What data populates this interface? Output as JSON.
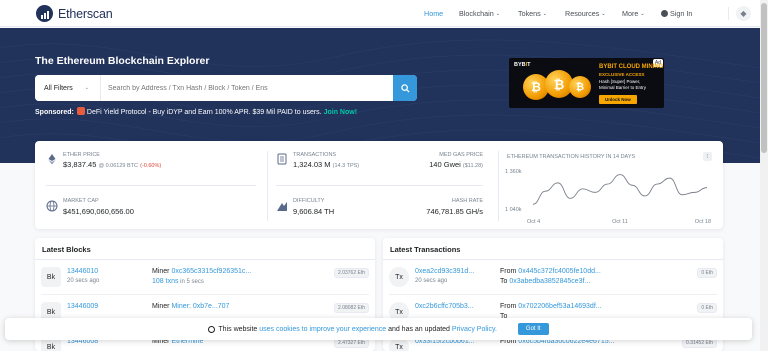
{
  "header": {
    "logo_text": "Etherscan",
    "nav": [
      {
        "label": "Home",
        "dropdown": false,
        "active": true
      },
      {
        "label": "Blockchain",
        "dropdown": true,
        "active": false
      },
      {
        "label": "Tokens",
        "dropdown": true,
        "active": false
      },
      {
        "label": "Resources",
        "dropdown": true,
        "active": false
      },
      {
        "label": "More",
        "dropdown": true,
        "active": false
      },
      {
        "label": "Sign In",
        "dropdown": false,
        "active": false
      }
    ]
  },
  "hero": {
    "title": "The Ethereum Blockchain Explorer",
    "filter_label": "All Filters",
    "search_placeholder": "Search by Address / Txn Hash / Block / Token / Ens",
    "sponsored_label": "Sponsored:",
    "sponsored_text": "DeFi Yield Protocol - Buy iDYP and Earn 100% APR. $39 Mil PAID to users.",
    "sponsored_link": "Join Now!"
  },
  "ad": {
    "tag": "Ad",
    "brand_prefix": "BYB",
    "brand_suffix": "T",
    "headline": "BYBIT CLOUD MINING",
    "subheadline": "EXCLUSIVE ACCESS",
    "line1": "Hash [Super] Power,",
    "line2": "Minimal Barrier to Entry",
    "button": "Unlock Now"
  },
  "stats": {
    "ether_price_label": "ETHER PRICE",
    "ether_price_value": "$3,837.45",
    "ether_price_btc": "@ 0.06129 BTC",
    "ether_price_change": "(-0.60%)",
    "transactions_label": "TRANSACTIONS",
    "transactions_value": "1,324.03 M",
    "transactions_tps": "(14.3 TPS)",
    "gas_label": "MED GAS PRICE",
    "gas_value": "140 Gwei",
    "gas_usd": "($11.28)",
    "market_cap_label": "MARKET CAP",
    "market_cap_value": "$451,690,060,656.00",
    "difficulty_label": "DIFFICULTY",
    "difficulty_value": "9,606.84 TH",
    "hashrate_label": "HASH RATE",
    "hashrate_value": "746,781.85 GH/s",
    "chart_menu": "⁝"
  },
  "chart_data": {
    "type": "line",
    "title": "ETHEREUM TRANSACTION HISTORY IN 14 DAYS",
    "x": [
      "Oct 4",
      "Oct 5",
      "Oct 6",
      "Oct 7",
      "Oct 8",
      "Oct 9",
      "Oct 10",
      "Oct 11",
      "Oct 12",
      "Oct 13",
      "Oct 14",
      "Oct 15",
      "Oct 16",
      "Oct 17",
      "Oct 18"
    ],
    "values": [
      1080,
      1190,
      1260,
      1130,
      1210,
      1180,
      1250,
      1330,
      1240,
      1150,
      1250,
      1300,
      1160,
      1180,
      1220
    ],
    "y_tick_labels": [
      "1 360k",
      "1 040k"
    ],
    "x_tick_labels": [
      "Oct 4",
      "Oct 11",
      "Oct 18"
    ],
    "ylim": [
      1040,
      1360
    ],
    "color": "#7a808a"
  },
  "latest_blocks": {
    "title": "Latest Blocks",
    "rows": [
      {
        "badge": "Bk",
        "block": "13446010",
        "age": "20 secs ago",
        "miner_prefix": "Miner",
        "miner": "0xc365c3315cf926351c...",
        "txns": "108 txns",
        "txns_time": "in 5 secs",
        "reward": "2.03762 Eth"
      },
      {
        "badge": "Bk",
        "block": "13446009",
        "age": "",
        "miner_prefix": "Miner",
        "miner": "Miner: 0xb7e...707",
        "txns": "",
        "txns_time": "",
        "reward": "2.08082 Eth"
      },
      {
        "badge": "Bk",
        "block": "13446008",
        "age": "",
        "miner_prefix": "Miner",
        "miner": "Ethermine",
        "txns": "",
        "txns_time": "",
        "reward": "2.47327 Eth"
      }
    ]
  },
  "latest_transactions": {
    "title": "Latest Transactions",
    "rows": [
      {
        "badge": "Tx",
        "hash": "0xea2cd93c391d...",
        "age": "20 secs ago",
        "from_label": "From",
        "from": "0x445c372fc4005fe10dd...",
        "to_label": "To",
        "to": "0x3abedba3852845ce3f...",
        "amount": "0 Eth"
      },
      {
        "badge": "Tx",
        "hash": "0xc2b6cffc705b3...",
        "age": "",
        "from_label": "From",
        "from": "0x702206bef53a14693df...",
        "to_label": "To",
        "to": "",
        "amount": "0 Eth"
      },
      {
        "badge": "Tx",
        "hash": "0x33f15f2cb0b61...",
        "age": "",
        "from_label": "From",
        "from": "0x6c5b4fda30c0622e4e6715...",
        "to_label": "",
        "to": "",
        "amount": "0.31452 Eth"
      }
    ]
  },
  "cookie": {
    "text_before": "This website",
    "link1": "uses cookies to improve your experience",
    "text_mid": "and has an updated",
    "link2": "Privacy Policy.",
    "button": "Got It"
  }
}
